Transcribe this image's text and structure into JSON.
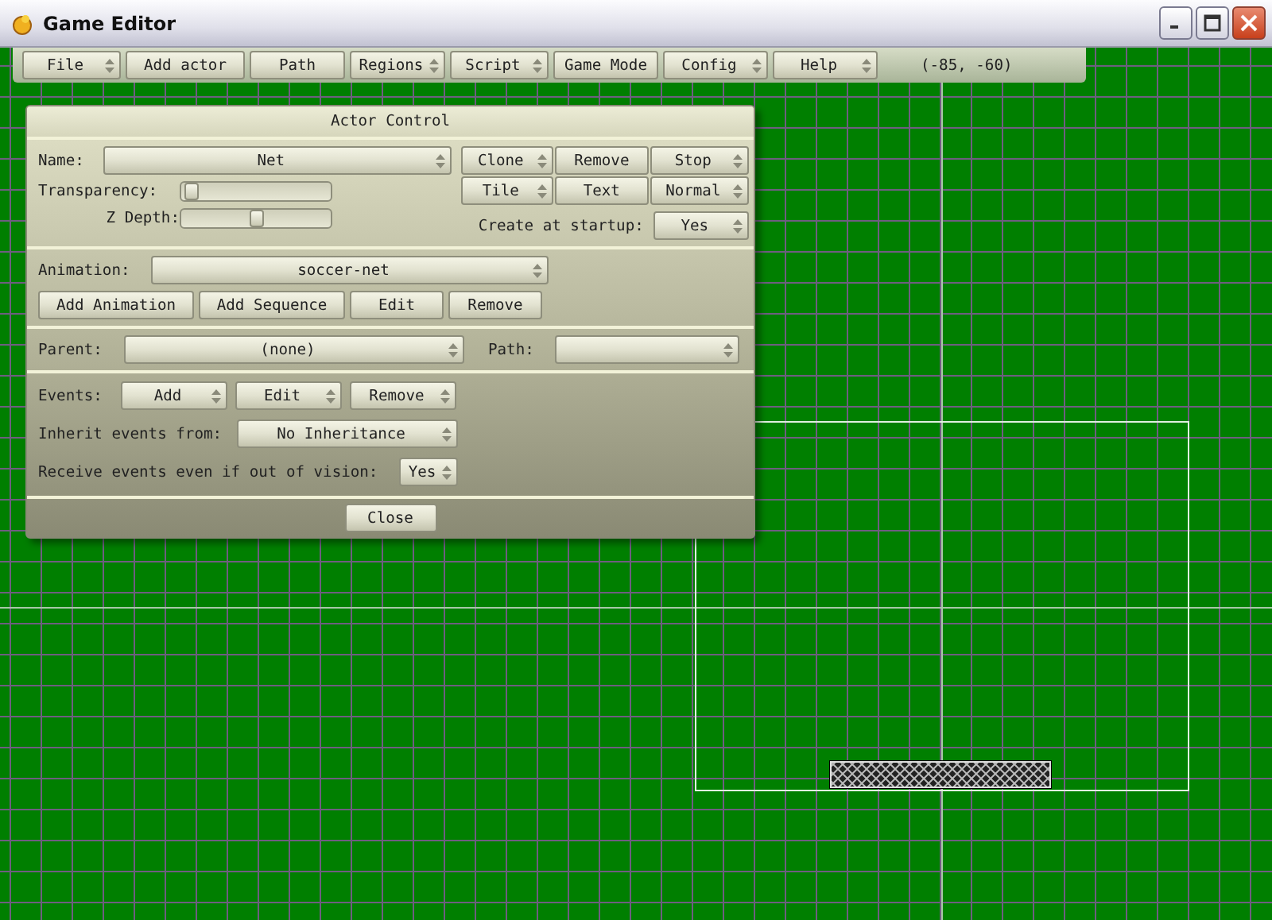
{
  "window": {
    "title": "Game Editor"
  },
  "toolbar": {
    "items": [
      {
        "label": "File",
        "kind": "dropdown"
      },
      {
        "label": "Add actor",
        "kind": "button"
      },
      {
        "label": "Path",
        "kind": "button"
      },
      {
        "label": "Regions",
        "kind": "dropdown"
      },
      {
        "label": "Script",
        "kind": "dropdown"
      },
      {
        "label": "Game Mode",
        "kind": "button"
      },
      {
        "label": "Config",
        "kind": "dropdown"
      },
      {
        "label": "Help",
        "kind": "dropdown"
      }
    ],
    "coordinates": "(-85, -60)"
  },
  "actor_control": {
    "title": "Actor Control",
    "name": {
      "label": "Name:",
      "value": "Net"
    },
    "transparency": {
      "label": "Transparency:",
      "level": 0.02
    },
    "z_depth": {
      "label": "Z Depth:",
      "level": 0.5
    },
    "buttons": [
      {
        "label": "Clone",
        "kind": "dropdown"
      },
      {
        "label": "Remove",
        "kind": "button"
      },
      {
        "label": "Stop",
        "kind": "dropdown"
      },
      {
        "label": "Tile",
        "kind": "dropdown"
      },
      {
        "label": "Text",
        "kind": "button"
      },
      {
        "label": "Normal",
        "kind": "dropdown"
      }
    ],
    "create_at_startup": {
      "label": "Create at startup:",
      "value": "Yes"
    },
    "animation": {
      "label": "Animation:",
      "value": "soccer-net"
    },
    "animation_buttons": [
      {
        "label": "Add Animation"
      },
      {
        "label": "Add Sequence"
      },
      {
        "label": "Edit"
      },
      {
        "label": "Remove"
      }
    ],
    "parent": {
      "label": "Parent:",
      "value": "(none)"
    },
    "path": {
      "label": "Path:"
    },
    "events": {
      "label": "Events:",
      "buttons": [
        {
          "label": "Add",
          "kind": "dropdown"
        },
        {
          "label": "Edit",
          "kind": "dropdown"
        },
        {
          "label": "Remove",
          "kind": "dropdown"
        }
      ]
    },
    "inherit": {
      "label": "Inherit events from:",
      "value": "No Inheritance"
    },
    "receive": {
      "label": "Receive events even if out of vision:",
      "value": "Yes"
    },
    "close": "Close"
  }
}
